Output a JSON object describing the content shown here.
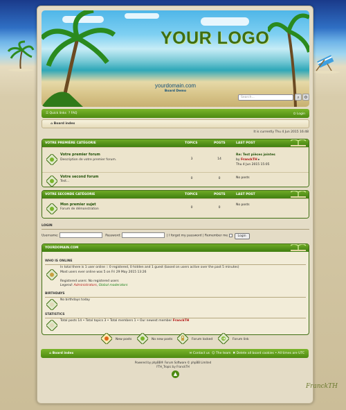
{
  "header": {
    "logo": "YOUR LOGO",
    "domain": "yourdomain.com",
    "description": "Board Demo",
    "search_placeholder": "Search..."
  },
  "navbar": {
    "quick_links": "Quick links",
    "faq": "FAQ",
    "login": "Login"
  },
  "breadcrumb": {
    "board_index": "Board index"
  },
  "current_time": "It is currently Thu 4 Jun 2015 16:48",
  "categories": [
    {
      "title": "VOTRE PREMIÈRE CATÉGORIE",
      "col_topics": "TOPICS",
      "col_posts": "POSTS",
      "col_lastpost": "LAST POST",
      "forums": [
        {
          "name": "Votre premier forum",
          "desc": "Description de votre premier forum.",
          "topics": "3",
          "posts": "14",
          "last_title": "Re: Test pièces jointes",
          "last_by": "by",
          "last_author": "FranckTH",
          "last_date": "Thu 4 Jun 2015 15:05"
        },
        {
          "name": "Votre second forum",
          "desc": "Test...",
          "topics": "0",
          "posts": "0",
          "last_title": "No posts"
        }
      ]
    },
    {
      "title": "VOTRE SECONDE CATÉGORIE",
      "col_topics": "TOPICS",
      "col_posts": "POSTS",
      "col_lastpost": "LAST POST",
      "forums": [
        {
          "name": "Mon premier sujet",
          "desc": "Forum de démonstration",
          "topics": "0",
          "posts": "0",
          "last_title": "No posts"
        }
      ]
    }
  ],
  "login_form": {
    "title": "LOGIN",
    "username_label": "Username:",
    "password_label": "Password:",
    "forgot": "I forgot my password",
    "remember": "Remember me",
    "button": "Login"
  },
  "stats": {
    "title": "YOURDOMAIN.COM",
    "online_title": "WHO IS ONLINE",
    "online_line1": "In total there is 1 user online :: 0 registered, 0 hidden and 1 guest (based on users active over the past 5 minutes)",
    "online_line2": "Most users ever online was 5 on Fri 29 May 2015 13:26",
    "online_line3": "Registered users: No registered users",
    "legend_label": "Legend:",
    "legend_admins": "Administrators",
    "legend_mods": "Global moderators",
    "birthdays_title": "BIRTHDAYS",
    "birthdays_text": "No birthdays today",
    "statistics_title": "STATISTICS",
    "statistics_text": "Total posts 14 • Total topics 3 • Total members 1 • Our newest member",
    "newest_member": "FranckTH"
  },
  "legend_icons": {
    "new_posts": "New posts",
    "no_new_posts": "No new posts",
    "forum_locked": "Forum locked",
    "forum_link": "Forum link"
  },
  "footer": {
    "board_index": "Board index",
    "contact": "Contact us",
    "team": "The team",
    "delete_cookies": "Delete all board cookies",
    "timezone": "All times are UTC",
    "powered": "Powered by phpBB® Forum Software © phpBB Limited",
    "style": "FTH_Tropic by FranckTH"
  },
  "signature": "FranckTH"
}
